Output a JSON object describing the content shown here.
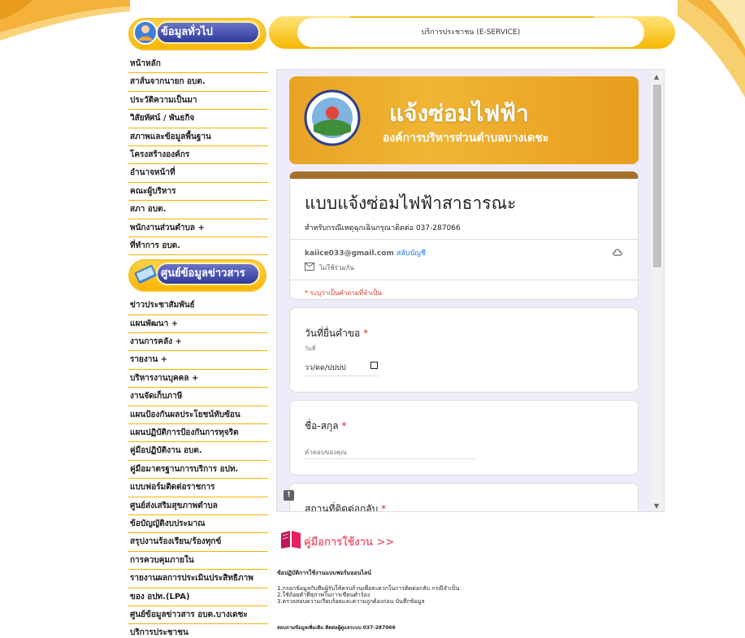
{
  "header": {
    "section_general": "ข้อมูลทั่วไป",
    "section_news": "ศูนย์ข้อมูลข่าวสาร",
    "eservice_title": "บริการประชาชน (E-SERVICE)"
  },
  "sidebar": {
    "general_items": [
      "หน้าหลัก",
      "สาส์นจากนายก อบต.",
      "ประวัติความเป็นมา",
      "วิสัยทัศน์ / พันธกิจ",
      "สภาพและข้อมูลพื้นฐาน",
      "โครงสร้างองค์กร",
      "อำนาจหน้าที่",
      "คณะผู้บริหาร",
      "สภา อบต.",
      "พนักงานส่วนตำบล +",
      "ที่ทำการ อบต."
    ],
    "news_items": [
      "ข่าวประชาสัมพันธ์",
      "แผนพัฒนา +",
      "งานการคลัง +",
      "รายงาน +",
      "บริหารงานบุคคล +",
      "งานจัดเก็บภาษี",
      "แผนป้องกันผลประโยชน์ทับซ้อน",
      "แผนปฏิบัติการป้องกันการทุจริต",
      "คู่มือปฏิบัติงาน อบต.",
      "คู่มือมาตรฐานการบริการ อปท.",
      "แบบฟอร์มติดต่อราชการ",
      "ศูนย์ส่งเสริมสุขภาพตำบล",
      "ข้อบัญญัติงบประมาณ",
      "สรุปงานร้องเรียน/ร้องทุกข์",
      "การควบคุมภายใน",
      "รายงานผลการประเมินประสิทธิภาพ",
      "ของ อปท.(LPA)",
      "ศูนย์ข้อมูลข่าวสาร อบต.บางเดชะ",
      "บริการประชาชน"
    ]
  },
  "form": {
    "banner_title": "แจ้งซ่อมไฟฟ้า",
    "banner_subtitle": "องค์การบริหารส่วนตำบลบางเดชะ",
    "title": "แบบแจ้งซ่อมไฟฟ้าสาธารณะ",
    "description": "สำหรับกรณีเหตุฉุกเฉินกรุณาติดต่อ 037-287066",
    "email": "kaiice033@gmail.com",
    "switch_account": "สลับบัญชี",
    "not_shared": "ไม่ใช้ร่วมกัน",
    "required_note": "* ระบุว่าเป็นคำถามที่จำเป็น",
    "q1_label": "วันที่ยื่นคำขอ",
    "q1_sublabel": "วันที่",
    "q1_value": "วว/ดด/ปปปป",
    "q2_label": "ชื่อ-สกุล",
    "q2_placeholder": "คำตอบของคุณ",
    "q3_label": "สถานที่ติดต่อกลับ",
    "required_mark": "*"
  },
  "guide": {
    "link": "คู่มือการใช้งาน >>",
    "steps_title": "ข้อปฏิบัติการใช้งานแบบฟอร์มออนไลน์",
    "steps": [
      "1.กรอกข้อมูลกับทีมผู้รับให้ครบถ้วนเพื่อสะดวกในการติดต่อกลับ กรณีจำเป็น",
      "2.ใช้ถ้อยคำที่สุภาพในการเขียนคำร้อง",
      "3.ตรวจสอบความเรียบร้อยและความถูกต้องก่อน บันทึกข้อมูล"
    ],
    "contact": "สอบถามข้อมูลเพิ่มเติม ติดต่อผู้ดูแลระบบ 037-287066"
  },
  "colors": {
    "accent_gold": "#f5b800",
    "header_band": "#a5702a",
    "link_blue": "#1a73e8",
    "required_red": "#d93025",
    "guide_pink": "#ea6a7e"
  }
}
